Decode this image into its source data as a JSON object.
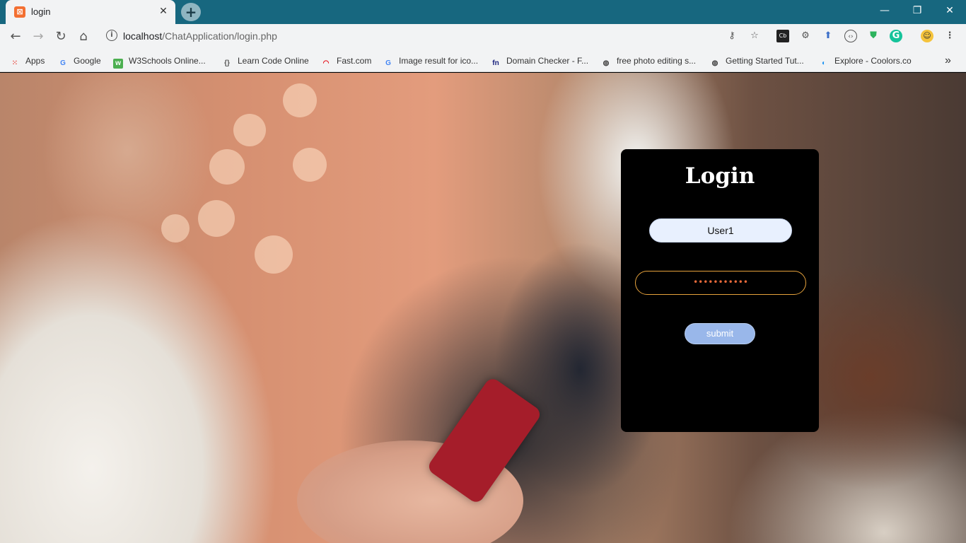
{
  "browser": {
    "tab_title": "login",
    "tab_favicon": "xampp-icon",
    "new_tab_label": "+",
    "url_host": "localhost",
    "url_path": "/ChatApplication/login.php",
    "window_controls": {
      "minimize": "—",
      "maximize": "❐",
      "close": "✕"
    }
  },
  "bookmarks": [
    {
      "label": "Apps",
      "icon": "apps-grid-icon",
      "color": "#e8453c"
    },
    {
      "label": "Google",
      "icon": "google-icon",
      "color": "#4285f4"
    },
    {
      "label": "W3Schools Online...",
      "icon": "w3schools-icon",
      "color": "#4caf50"
    },
    {
      "label": "Learn Code Online",
      "icon": "code-icon",
      "color": "#555555"
    },
    {
      "label": "Fast.com",
      "icon": "fast-icon",
      "color": "#e50914"
    },
    {
      "label": "Image result for ico...",
      "icon": "google-icon",
      "color": "#4285f4"
    },
    {
      "label": "Domain Checker - F...",
      "icon": "freenom-icon",
      "color": "#1a237e"
    },
    {
      "label": "free photo editing s...",
      "icon": "globe-icon",
      "color": "#444444"
    },
    {
      "label": "Getting Started Tut...",
      "icon": "globe-icon",
      "color": "#444444"
    },
    {
      "label": "Explore - Coolors.co",
      "icon": "coolors-icon",
      "color": "#2196f3"
    }
  ],
  "bookmarks_overflow": "»",
  "login": {
    "title": "Login",
    "username_value": "User1",
    "password_value": "•••••••••••",
    "submit_label": "submit"
  },
  "colors": {
    "titlebar": "#17677f",
    "card_bg": "#000000",
    "password_border": "#e6a23c",
    "submit_bg": "#99b7ea"
  }
}
